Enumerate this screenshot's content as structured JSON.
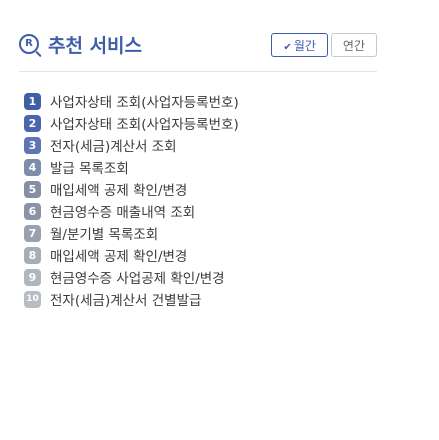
{
  "header": {
    "icon_letter": "R",
    "title": "추천 서비스",
    "toggle": {
      "monthly": "월간",
      "yearly": "연간"
    }
  },
  "services": [
    {
      "rank": "1",
      "label": "사업자상태 조회(사업자등록번호)"
    },
    {
      "rank": "2",
      "label": "사업자상태 조회(사업자등록번호)"
    },
    {
      "rank": "3",
      "label": "전자(세금)계산서 조회"
    },
    {
      "rank": "4",
      "label": "발급 목록조회"
    },
    {
      "rank": "5",
      "label": "매입세액 공제 확인/변경"
    },
    {
      "rank": "6",
      "label": "현금영수증 매출내역 조회"
    },
    {
      "rank": "7",
      "label": "월/분기별 목록조회"
    },
    {
      "rank": "8",
      "label": "매입세액 공제 확인/변경"
    },
    {
      "rank": "9",
      "label": "현금영수증 사업공제 확인/변경"
    },
    {
      "rank": "10",
      "label": "전자(세금)계산서 건별발급"
    }
  ],
  "colors": {
    "accent": "#3f5ea8",
    "text": "#3b3b3b",
    "border": "#c5c9d3"
  }
}
